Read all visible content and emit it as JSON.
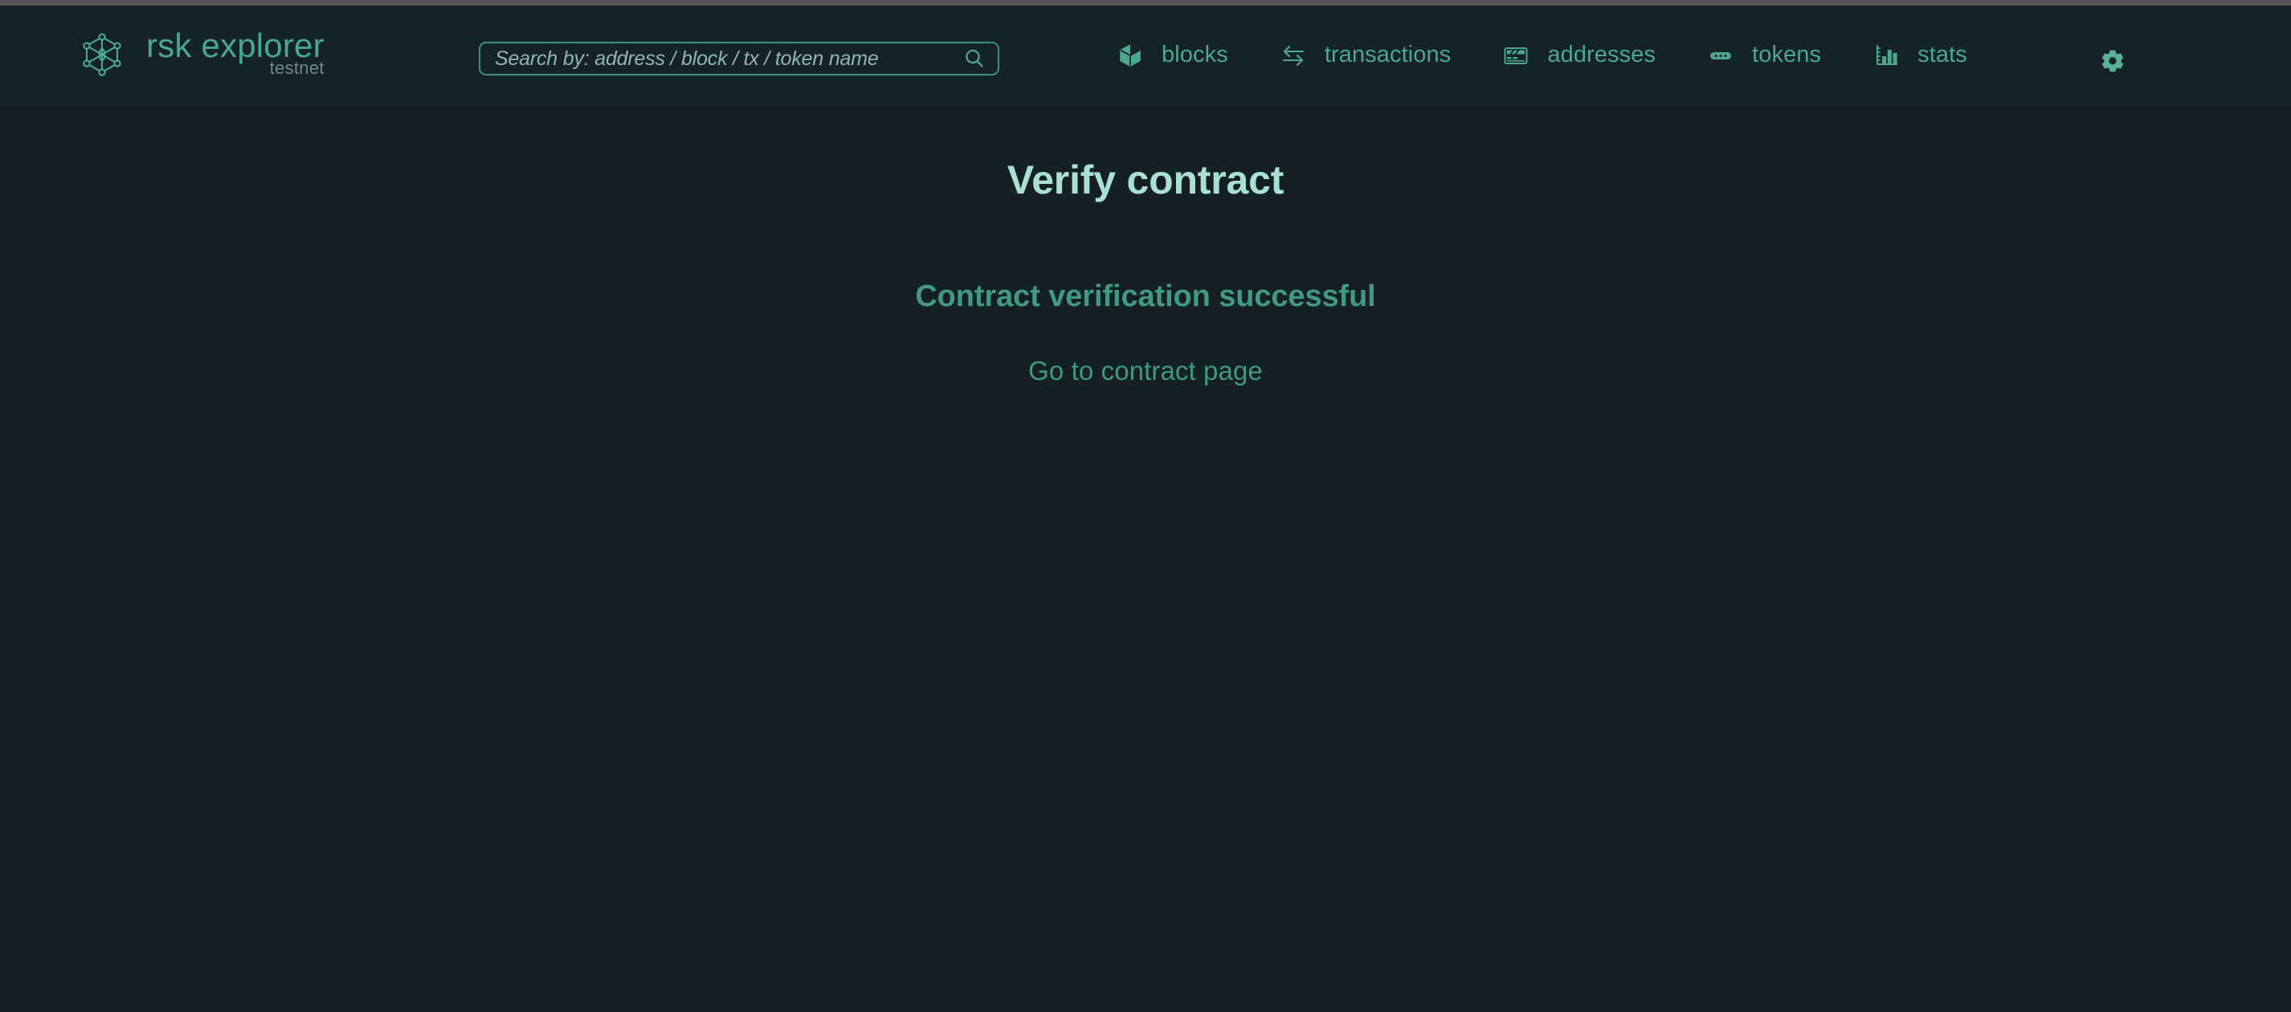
{
  "colors": {
    "page_background": "#141f26",
    "header_background": "#16222a",
    "accent_green": "#4ba88c",
    "title_mint": "#a9e0d1",
    "status_green": "#43997f",
    "link_green": "#3f9a7c",
    "subtitle_gray": "#6f8a86",
    "border_green": "#3d9176",
    "top_strip_gray": "#555555"
  },
  "header": {
    "brand": {
      "logo_icon": "rsk-network-hexagon-icon",
      "title": "rsk explorer",
      "subtitle": "testnet"
    },
    "search": {
      "placeholder": "Search by: address / block / tx / token name",
      "value": "",
      "icon": "search-icon"
    },
    "nav": [
      {
        "id": "blocks",
        "label": "blocks",
        "icon": "cube-icon"
      },
      {
        "id": "transactions",
        "label": "transactions",
        "icon": "swap-arrows-icon"
      },
      {
        "id": "addresses",
        "label": "addresses",
        "icon": "card-icon"
      },
      {
        "id": "tokens",
        "label": "tokens",
        "icon": "token-pill-icon"
      },
      {
        "id": "stats",
        "label": "stats",
        "icon": "bar-chart-icon"
      }
    ],
    "settings": {
      "icon": "gear-icon",
      "label": "settings"
    }
  },
  "main": {
    "page_title": "Verify contract",
    "status_message": "Contract verification successful",
    "contract_link": "Go to contract page"
  }
}
